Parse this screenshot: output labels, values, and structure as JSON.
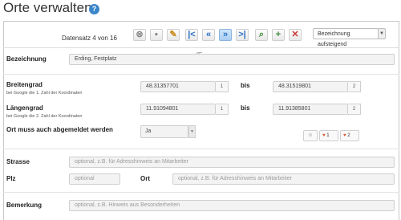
{
  "page": {
    "title": "Orte verwalten",
    "help_icon": "question-circle-icon"
  },
  "toolbar": {
    "counter": "Datensatz 4 von 16",
    "buttons": [
      {
        "name": "delete-button",
        "icon": "cancel-circle-icon",
        "glyph": "⊗"
      },
      {
        "name": "save-button",
        "icon": "floppy-disk-icon",
        "glyph": "▪"
      },
      {
        "name": "edit-button",
        "icon": "pencil-icon",
        "glyph": "✎"
      },
      {
        "name": "first-record-button",
        "icon": "first-icon",
        "glyph": "|<"
      },
      {
        "name": "previous-record-button",
        "icon": "double-left-icon",
        "glyph": "«"
      },
      {
        "name": "next-record-button",
        "icon": "double-right-icon",
        "glyph": "»"
      },
      {
        "name": "last-record-button",
        "icon": "last-icon",
        "glyph": ">|"
      },
      {
        "name": "search-button",
        "icon": "magnifier-icon",
        "glyph": "⌕"
      },
      {
        "name": "new-record-button",
        "icon": "new-document-icon",
        "glyph": "+"
      },
      {
        "name": "remove-record-button",
        "icon": "delete-document-icon",
        "glyph": "✕"
      }
    ],
    "sort": {
      "selected": "Bezeichnung aufsteigend"
    }
  },
  "form": {
    "bezeichnung": {
      "label": "Bezeichnung",
      "value": "Erding, Festplatz"
    },
    "breitengrad": {
      "label": "Breitengrad",
      "hint": "bei Google die 1. Zahl der Koordinaten",
      "from": "48.31357701",
      "from_badge": "1",
      "bis_label": "bis",
      "to": "48.31519801",
      "to_badge": "2"
    },
    "laengengrad": {
      "label": "Längengrad",
      "hint": "bei Google die 2. Zahl der Koordinaten",
      "from": "11.91094801",
      "from_badge": "1",
      "bis_label": "bis",
      "to": "11.91385801",
      "to_badge": "2"
    },
    "abmelden": {
      "label": "Ort muss auch abgemeldet werden",
      "value": "Ja",
      "pins": [
        "1",
        "2"
      ]
    },
    "strasse": {
      "label": "Strasse",
      "placeholder": "optional, z.B. für Adresshinweis an Mitarbeiter"
    },
    "plz": {
      "label": "Plz",
      "placeholder": "optional"
    },
    "ort": {
      "label": "Ort",
      "placeholder": "optional, z.B. für Adresshinweis an Mitarbeiter"
    },
    "bemerkung": {
      "label": "Bemerkung",
      "placeholder": "optional, z.B. Hinweis aus Besonderheiten"
    }
  },
  "colors": {
    "accent": "#2b6fc2",
    "pin": "#d9532b"
  }
}
